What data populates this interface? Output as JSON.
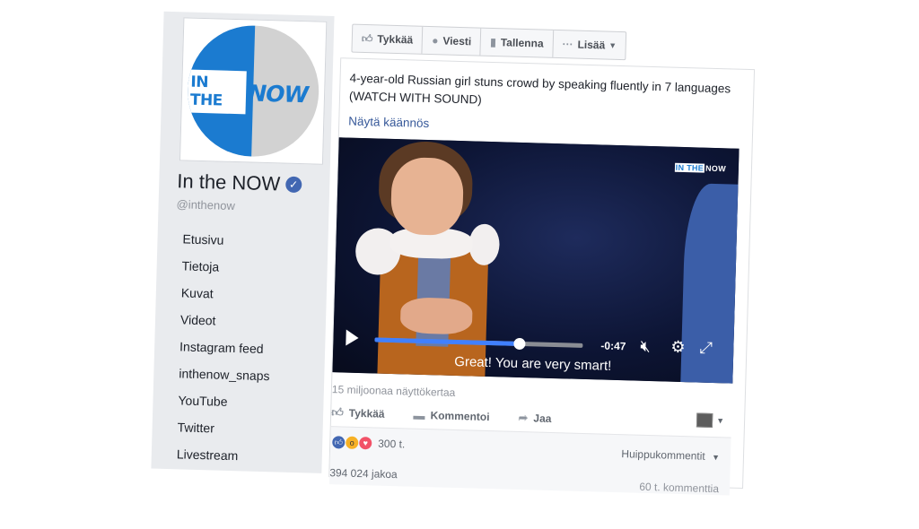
{
  "page": {
    "name": "In the NOW",
    "handle": "@inthenow",
    "logo": {
      "word_in": "IN THE",
      "word_now": "NOW"
    },
    "nav": [
      "Etusivu",
      "Tietoja",
      "Kuvat",
      "Videot",
      "Instagram feed",
      "inthenow_snaps",
      "YouTube",
      "Twitter",
      "Livestream"
    ]
  },
  "actions": {
    "like": "Tykkää",
    "message": "Viesti",
    "save": "Tallenna",
    "more": "Lisää"
  },
  "post": {
    "text": "4-year-old Russian girl stuns crowd by speaking fluently in 7 languages (WATCH WITH SOUND)",
    "translate_link": "Näytä käännös",
    "video": {
      "watermark_in": "IN THE",
      "watermark_now": "NOW",
      "subtitle": "Great! You are very smart!",
      "time_remaining": "-0:47",
      "progress_fraction": 0.77
    },
    "views": "15 miljoonaa näyttökertaa",
    "buttons": {
      "like": "Tykkää",
      "comment": "Kommentoi",
      "share": "Jaa"
    },
    "reactions_count": "300 t.",
    "top_comments": "Huippukommentit",
    "shares": "394 024 jakoa",
    "comments_count": "60 t. kommenttia"
  },
  "colors": {
    "brand_blue": "#1b7bd0",
    "facebook_blue": "#4267b2",
    "progress": "#4080ff"
  }
}
